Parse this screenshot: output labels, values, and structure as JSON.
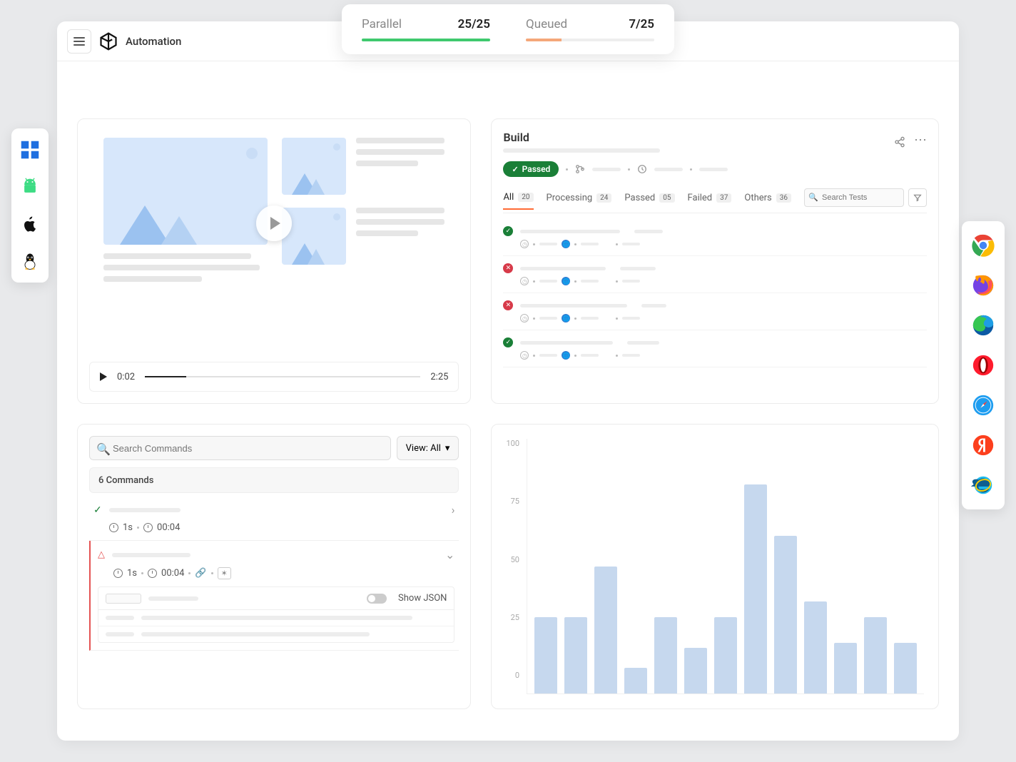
{
  "header": {
    "title": "Automation"
  },
  "status": {
    "parallel": {
      "label": "Parallel",
      "value": "25/25",
      "pct": 100,
      "color": "#3fc96e"
    },
    "queued": {
      "label": "Queued",
      "value": "7/25",
      "pct": 28,
      "color": "#f5a77a"
    }
  },
  "video": {
    "time_current": "0:02",
    "time_total": "2:25"
  },
  "build": {
    "title": "Build",
    "status_label": "Passed",
    "tabs": [
      {
        "label": "All",
        "count": "20",
        "active": true
      },
      {
        "label": "Processing",
        "count": "24"
      },
      {
        "label": "Passed",
        "count": "05"
      },
      {
        "label": "Failed",
        "count": "37"
      },
      {
        "label": "Others",
        "count": "36"
      }
    ],
    "search_placeholder": "Search Tests",
    "tests": [
      {
        "status": "pass"
      },
      {
        "status": "fail"
      },
      {
        "status": "fail"
      },
      {
        "status": "pass"
      }
    ]
  },
  "commands": {
    "search_placeholder": "Search Commands",
    "view_label": "View: All",
    "count_label": "6 Commands",
    "items": [
      {
        "status": "ok",
        "duration": "1s",
        "timestamp": "00:04"
      },
      {
        "status": "warn",
        "duration": "1s",
        "timestamp": "00:04"
      }
    ],
    "json_toggle_label": "Show JSON"
  },
  "chart_data": {
    "type": "bar",
    "title": "",
    "xlabel": "",
    "ylabel": "",
    "ylim": [
      0,
      100
    ],
    "yticks": [
      100,
      75,
      50,
      25,
      0
    ],
    "values": [
      30,
      30,
      50,
      10,
      30,
      18,
      30,
      82,
      62,
      36,
      20,
      30,
      20
    ]
  },
  "os_icons": [
    "windows",
    "android",
    "apple",
    "linux"
  ],
  "browser_icons": [
    "chrome",
    "firefox",
    "edge",
    "opera",
    "safari",
    "yandex",
    "ie"
  ]
}
